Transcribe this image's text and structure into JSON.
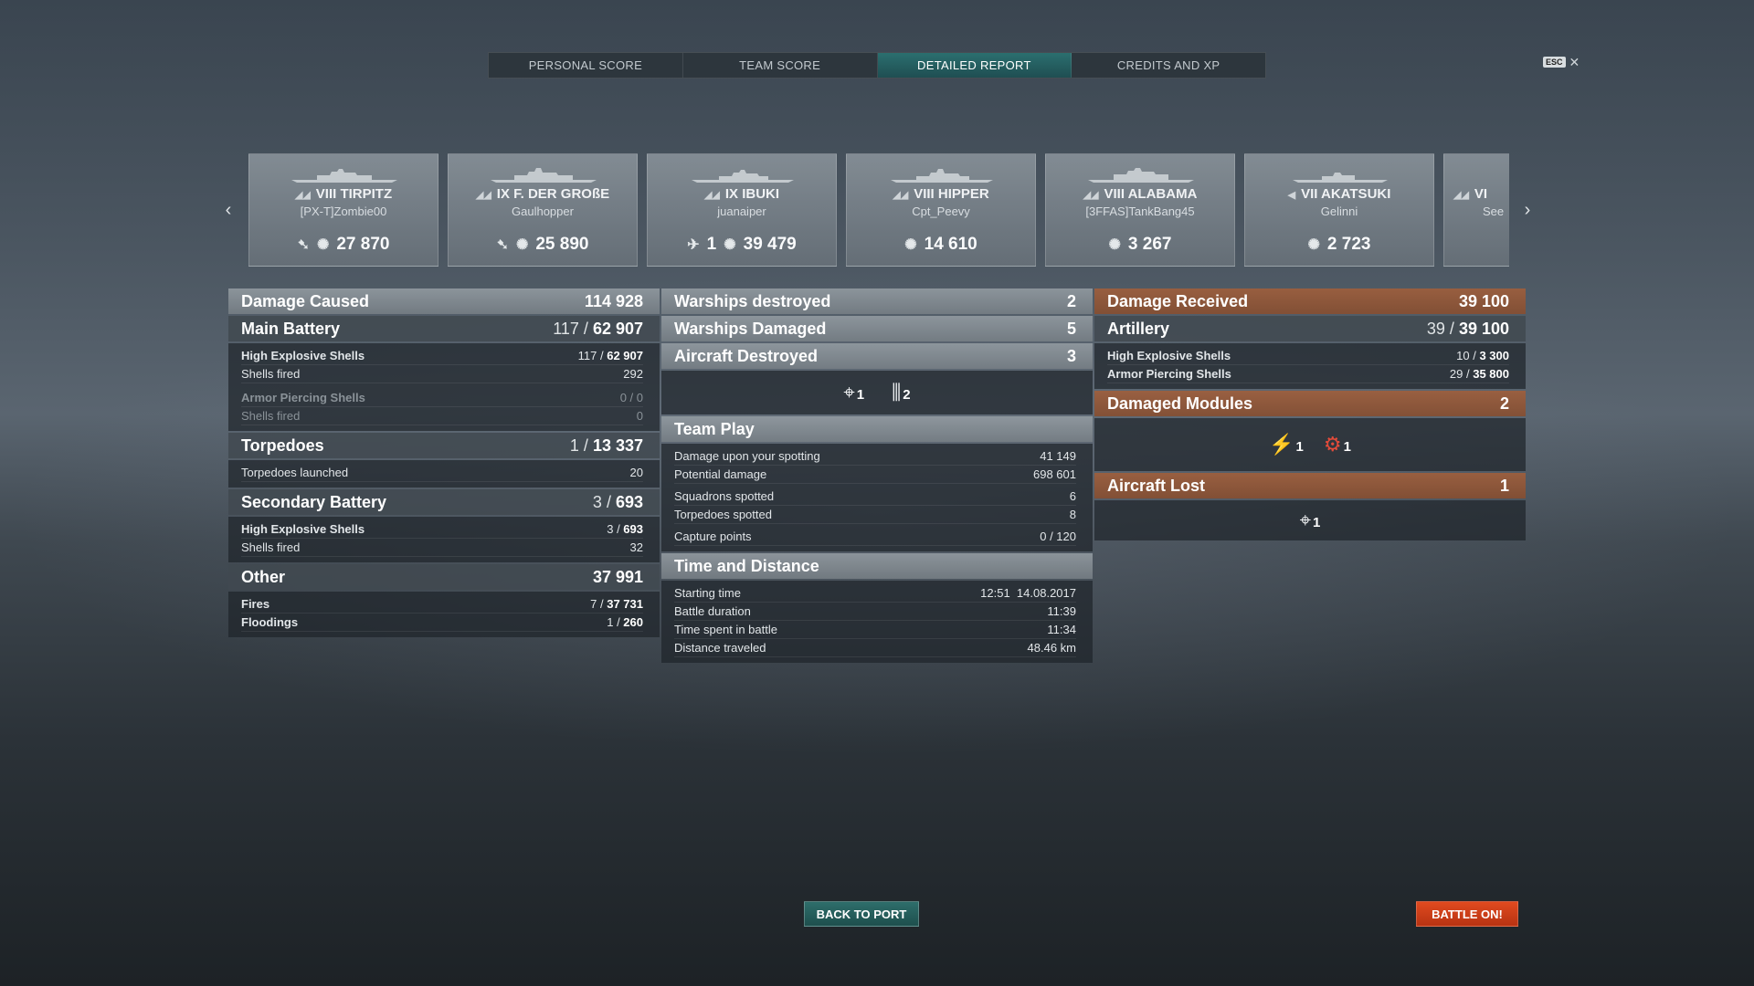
{
  "tabs": [
    {
      "label": "PERSONAL SCORE",
      "active": false
    },
    {
      "label": "TEAM SCORE",
      "active": false
    },
    {
      "label": "DETAILED REPORT",
      "active": true
    },
    {
      "label": "CREDITS AND XP",
      "active": false
    }
  ],
  "esc": {
    "key": "ESC",
    "close_glyph": "✕"
  },
  "carousel": {
    "prev_glyph": "‹",
    "next_glyph": "›",
    "ships": [
      {
        "name": "VIII TIRPITZ",
        "player": "[PX-T]Zombie00",
        "icons": [
          "torpedo-icon",
          "damage-icon"
        ],
        "damage": "27 870",
        "extra": ""
      },
      {
        "name": "IX F. DER GROßE",
        "player": "Gaulhopper",
        "icons": [
          "torpedo-icon",
          "damage-icon"
        ],
        "damage": "25 890",
        "extra": ""
      },
      {
        "name": "IX IBUKI",
        "player": "juanaiper",
        "icons": [
          "plane-kill-icon",
          "damage-icon"
        ],
        "damage": "39 479",
        "extra": "1"
      },
      {
        "name": "VIII HIPPER",
        "player": "Cpt_Peevy",
        "icons": [
          "damage-icon"
        ],
        "damage": "14 610",
        "extra": ""
      },
      {
        "name": "VIII ALABAMA",
        "player": "[3FFAS]TankBang45",
        "icons": [
          "damage-icon"
        ],
        "damage": "3 267",
        "extra": ""
      },
      {
        "name": "VII AKATSUKI",
        "player": "Gelinni",
        "icons": [
          "damage-icon"
        ],
        "damage": "2 723",
        "extra": ""
      },
      {
        "name": "VI",
        "player": "See",
        "icons": [],
        "damage": "",
        "extra": ""
      }
    ]
  },
  "damage_caused": {
    "title": "Damage Caused",
    "total": "114 928",
    "main_battery": {
      "title": "Main Battery",
      "part": "117",
      "value": "62 907",
      "he_label": "High Explosive Shells",
      "he_part": "117",
      "he_value": "62 907",
      "he_fired_label": "Shells fired",
      "he_fired": "292",
      "ap_label": "Armor Piercing Shells",
      "ap_value": "0 / 0",
      "ap_fired_label": "Shells fired",
      "ap_fired": "0"
    },
    "torpedoes": {
      "title": "Torpedoes",
      "part": "1",
      "value": "13 337",
      "launched_label": "Torpedoes launched",
      "launched": "20"
    },
    "secondary": {
      "title": "Secondary Battery",
      "part": "3",
      "value": "693",
      "he_label": "High Explosive Shells",
      "he_part": "3",
      "he_value": "693",
      "fired_label": "Shells fired",
      "fired": "32"
    },
    "other": {
      "title": "Other",
      "value": "37 991",
      "fires_label": "Fires",
      "fires_part": "7",
      "fires_value": "37 731",
      "flood_label": "Floodings",
      "flood_part": "1",
      "flood_value": "260"
    }
  },
  "middle": {
    "warships_destroyed": {
      "label": "Warships destroyed",
      "value": "2"
    },
    "warships_damaged": {
      "label": "Warships Damaged",
      "value": "5"
    },
    "aircraft_destroyed": {
      "label": "Aircraft Destroyed",
      "value": "3",
      "fighter_count": "1",
      "flak_count": "2"
    },
    "team_play": {
      "title": "Team Play",
      "rows": [
        {
          "label": "Damage upon your spotting",
          "value": "41 149"
        },
        {
          "label": "Potential damage",
          "value": "698 601"
        },
        {
          "label": "Squadrons spotted",
          "value": "6"
        },
        {
          "label": "Torpedoes spotted",
          "value": "8"
        },
        {
          "label": "Capture points",
          "value": "0 / 120"
        }
      ]
    },
    "time": {
      "title": "Time and Distance",
      "rows": [
        {
          "label": "Starting time",
          "value": "12:51  14.08.2017"
        },
        {
          "label": "Battle duration",
          "value": "11:39"
        },
        {
          "label": "Time spent in battle",
          "value": "11:34"
        },
        {
          "label": "Distance traveled",
          "value": "48.46 km"
        }
      ]
    }
  },
  "damage_received": {
    "title": "Damage Received",
    "total": "39 100",
    "artillery": {
      "title": "Artillery",
      "part": "39",
      "value": "39 100",
      "he_label": "High Explosive Shells",
      "he_part": "10",
      "he_value": "3 300",
      "ap_label": "Armor Piercing Shells",
      "ap_part": "29",
      "ap_value": "35 800"
    },
    "modules": {
      "title": "Damaged Modules",
      "value": "2",
      "gun_count": "1",
      "engine_count": "1"
    },
    "aircraft_lost": {
      "title": "Aircraft Lost",
      "value": "1",
      "fighter_count": "1"
    }
  },
  "buttons": {
    "back": "BACK TO PORT",
    "battle": "BATTLE ON!"
  },
  "colors": {
    "accent_teal": "#2b6f6f",
    "received_orange": "#a05f3c",
    "battle_red": "#e04a1f"
  }
}
